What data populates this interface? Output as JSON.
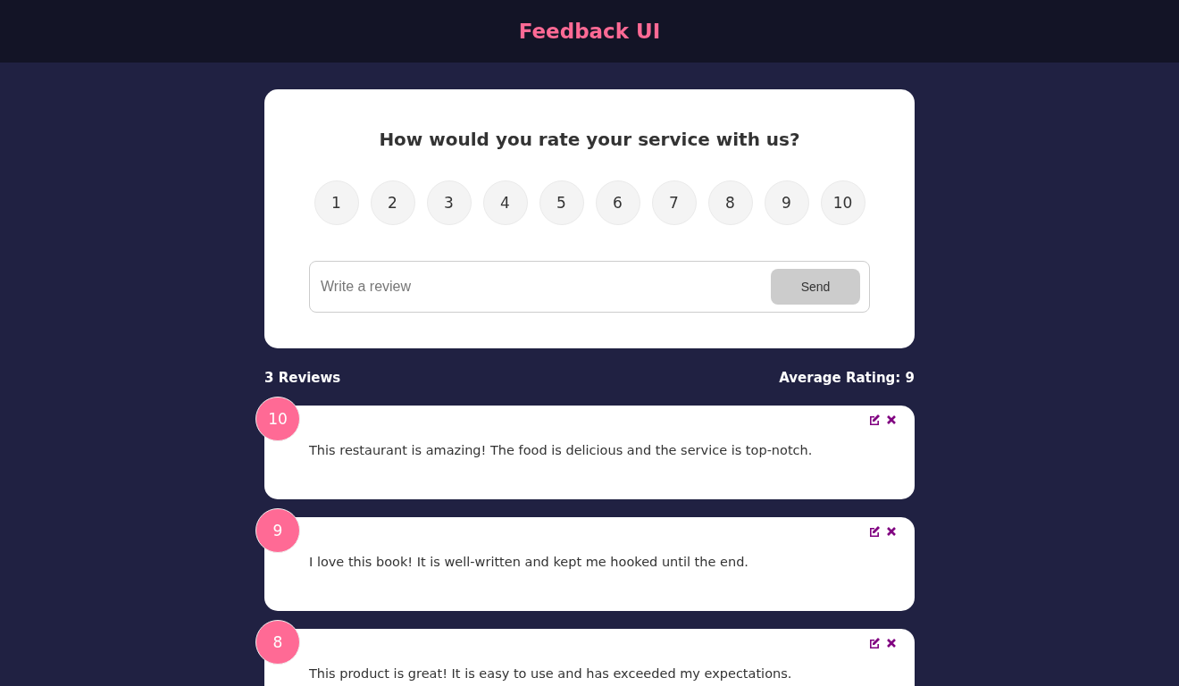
{
  "header": {
    "title": "Feedback UI"
  },
  "rating_card": {
    "question": "How would you rate your service with us?",
    "ratings": [
      {
        "label": "1",
        "selected": false
      },
      {
        "label": "2",
        "selected": false
      },
      {
        "label": "3",
        "selected": false
      },
      {
        "label": "4",
        "selected": false
      },
      {
        "label": "5",
        "selected": false
      },
      {
        "label": "6",
        "selected": false
      },
      {
        "label": "7",
        "selected": false
      },
      {
        "label": "8",
        "selected": false
      },
      {
        "label": "9",
        "selected": false
      },
      {
        "label": "10",
        "selected": false
      }
    ],
    "review_field": {
      "placeholder": "Write a review"
    },
    "send_button": {
      "label": "Send",
      "disabled": true
    }
  },
  "stats": {
    "count": "3 Reviews",
    "average": "Average Rating: 9"
  },
  "reviews": [
    {
      "rating": "10",
      "text": "This restaurant is amazing! The food is delicious and the service is top-notch."
    },
    {
      "rating": "9",
      "text": "I love this book! It is well-written and kept me hooked until the end."
    },
    {
      "rating": "8",
      "text": "This product is great! It is easy to use and has exceeded my expectations."
    }
  ]
}
